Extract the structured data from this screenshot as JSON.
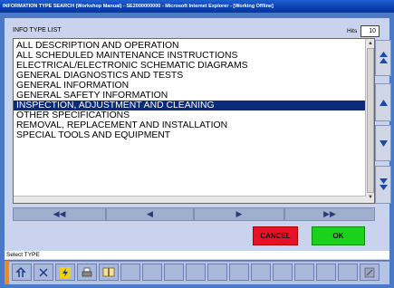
{
  "window": {
    "title": "INFORMATION TYPE SEARCH (Workshop Manual) - SE2000000000 - Microsoft Internet Explorer - [Working Offline]"
  },
  "header": {
    "info_type_label": "INFO TYPE LIST",
    "hits_label": "Hits",
    "hits_value": "10"
  },
  "list": {
    "items": [
      "ALL DESCRIPTION AND OPERATION",
      "ALL SCHEDULED MAINTENANCE INSTRUCTIONS",
      "ELECTRICAL/ELECTRONIC SCHEMATIC DIAGRAMS",
      "GENERAL DIAGNOSTICS AND TESTS",
      "GENERAL INFORMATION",
      "GENERAL SAFETY INFORMATION",
      "INSPECTION, ADJUSTMENT AND CLEANING",
      "OTHER SPECIFICATIONS",
      "REMOVAL, REPLACEMENT AND INSTALLATION",
      "SPECIAL TOOLS AND EQUIPMENT"
    ],
    "selected_index": 6
  },
  "side_buttons": [
    "page-up",
    "line-up",
    "line-down",
    "page-down"
  ],
  "nav_buttons": {
    "first": "◀◀",
    "prev": "◀",
    "next": "▶",
    "last": "▶▶"
  },
  "actions": {
    "cancel_label": "CANCEL",
    "ok_label": "OK"
  },
  "status": {
    "text": "Select TYPE"
  },
  "toolbar": {
    "icons": [
      "home-icon",
      "close-icon",
      "lightning-icon",
      "print-icon",
      "book-icon",
      "settings-icon"
    ]
  },
  "colors": {
    "frame": "#4a79c8",
    "panel": "#c9d3ee",
    "selection": "#0b2a7a",
    "cancel": "#e8112a",
    "ok": "#1bd21b",
    "accent": "#f08a1a"
  }
}
